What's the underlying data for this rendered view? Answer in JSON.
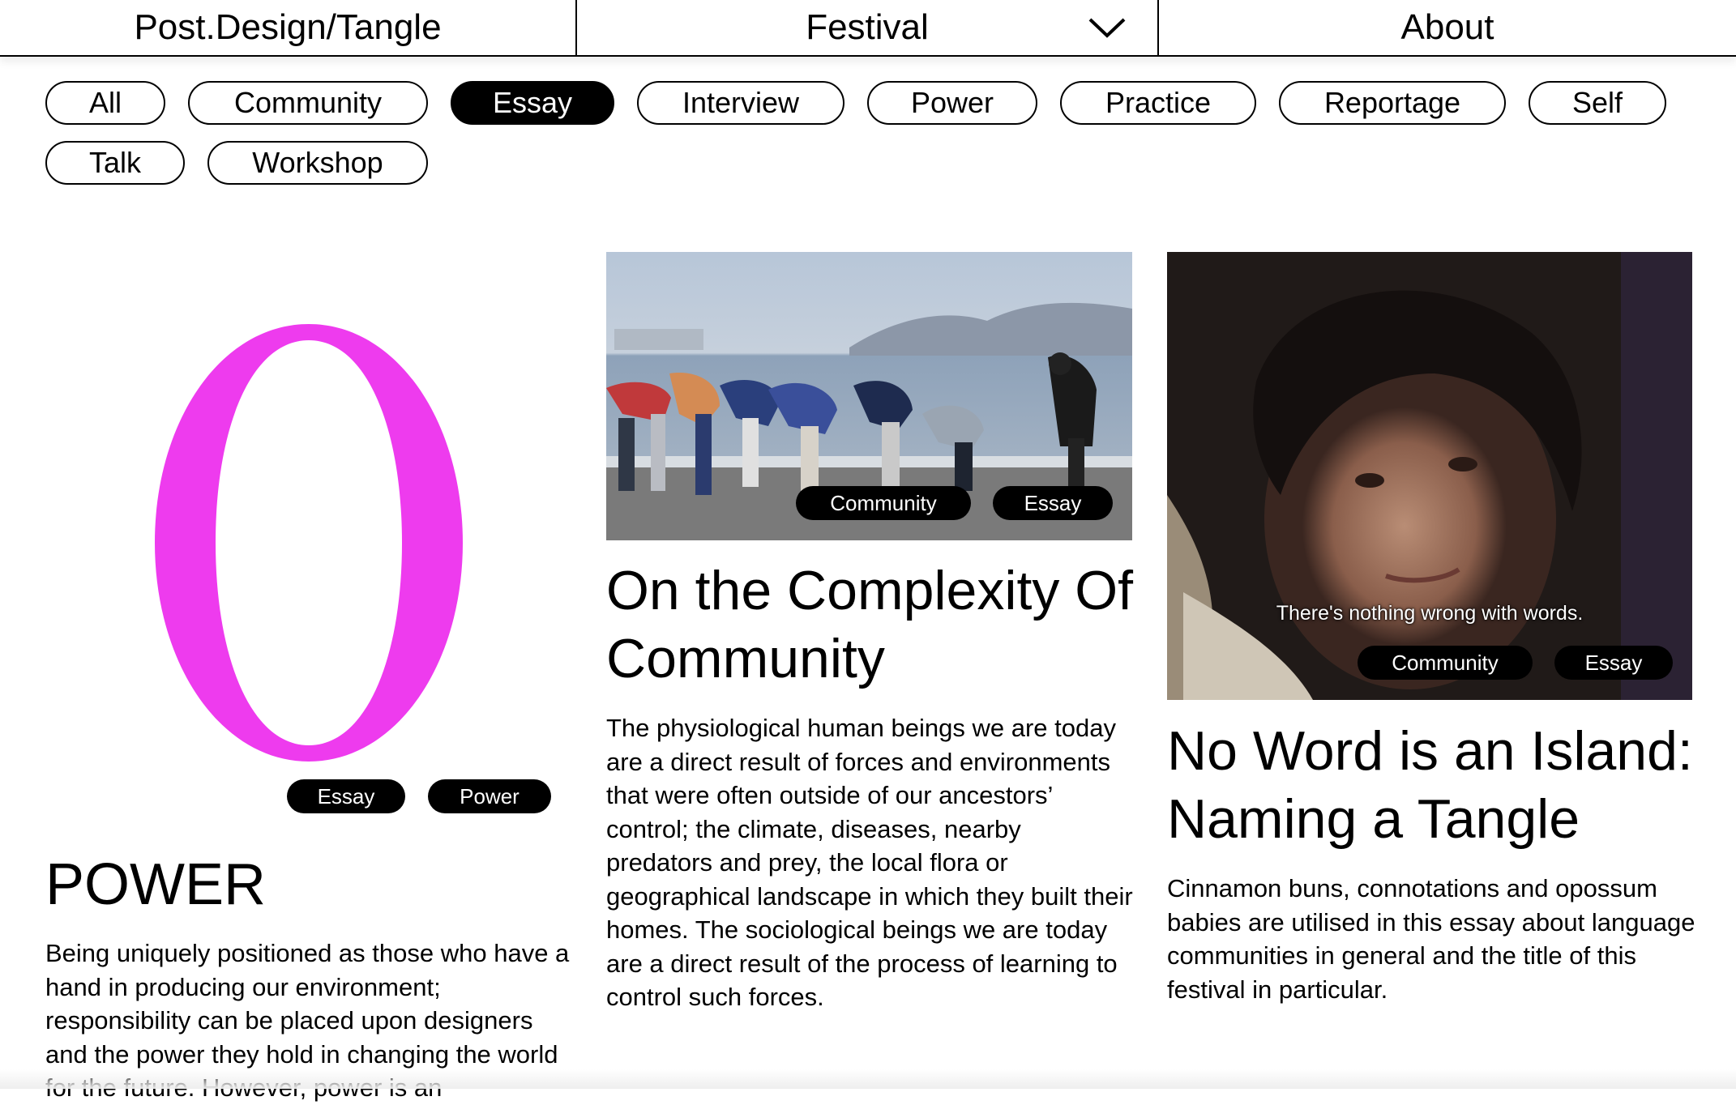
{
  "header": {
    "site_title": "Post.Design/Tangle",
    "festival_label": "Festival",
    "about_label": "About"
  },
  "filters": [
    {
      "label": "All",
      "active": false
    },
    {
      "label": "Community",
      "active": false
    },
    {
      "label": "Essay",
      "active": true
    },
    {
      "label": "Interview",
      "active": false
    },
    {
      "label": "Power",
      "active": false
    },
    {
      "label": "Practice",
      "active": false
    },
    {
      "label": "Reportage",
      "active": false
    },
    {
      "label": "Self",
      "active": false
    },
    {
      "label": "Talk",
      "active": false
    },
    {
      "label": "Workshop",
      "active": false
    }
  ],
  "cards": [
    {
      "graphic_letter": "O",
      "graphic_color": "#EE3BEE",
      "tags": [
        "Essay",
        "Power"
      ],
      "title": "POWER",
      "body": "Being uniquely positioned as those who have a hand in producing our environment; responsibility can be placed upon designers and the power they hold in changing the world for the future. However, power is an"
    },
    {
      "image": "people-stretching-by-the-sea-photo",
      "tags": [
        "Community",
        "Essay"
      ],
      "title": "On the Complexity Of Community",
      "body": "The physiological human beings we are today are a direct result of forces and environments that were often outside of our ancestors’ control; the climate, diseases, nearby predators and prey, the local flora or geographical landscape in which they built their homes. The sociological beings we are today are a direct result of the process of learning to control such forces."
    },
    {
      "image": "film-still-woman-portrait",
      "image_subtitle": "There's nothing wrong with words.",
      "tags": [
        "Community",
        "Essay"
      ],
      "title": "No Word is an Island: Naming a Tangle",
      "body": "Cinnamon buns, connotations and opossum babies are utilised in this essay about language communities in general and the title of this festival in particular."
    }
  ]
}
